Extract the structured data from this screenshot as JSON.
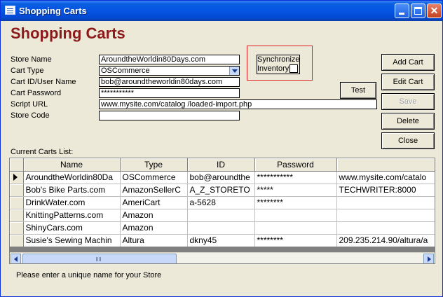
{
  "window": {
    "title": "Shopping Carts"
  },
  "heading": "Shopping Carts",
  "form": {
    "store_name": {
      "label": "Store Name",
      "value": "AroundtheWorldin80Days.com"
    },
    "cart_type": {
      "label": "Cart Type",
      "value": "OSCommerce"
    },
    "cart_id": {
      "label": "Cart ID/User Name",
      "value": "bob@aroundtheworldin80days.com"
    },
    "cart_password": {
      "label": "Cart Password",
      "value": "***********"
    },
    "script_url": {
      "label": "Script URL",
      "value": "www.mysite.com/catalog /loaded-import.php"
    },
    "store_code": {
      "label": "Store Code",
      "value": ""
    }
  },
  "sync": {
    "line1": "Synchronize",
    "line2": "Inventory",
    "checked": false
  },
  "buttons": {
    "add_cart": "Add Cart",
    "edit_cart": "Edit Cart",
    "save": "Save",
    "delete": "Delete",
    "close": "Close",
    "test": "Test"
  },
  "list": {
    "label": "Current Carts List:",
    "columns": [
      "Name",
      "Type",
      "ID",
      "Password",
      ""
    ],
    "rows": [
      [
        "AroundtheWorldin80Da",
        "OSCommerce",
        "bob@aroundthe",
        "***********",
        "www.mysite.com/catalo"
      ],
      [
        "Bob's Bike Parts.com",
        "AmazonSellerC",
        "A_Z_STORETO",
        "*****",
        "TECHWRITER:8000"
      ],
      [
        "DrinkWater.com",
        "AmeriCart",
        "a-5628",
        "********",
        ""
      ],
      [
        "KnittingPatterns.com",
        "Amazon",
        "",
        "",
        ""
      ],
      [
        "ShinyCars.com",
        "Amazon",
        "",
        "",
        ""
      ],
      [
        "Susie's Sewing Machin",
        "Altura",
        "dkny45",
        "********",
        "209.235.214.90/altura/a"
      ]
    ],
    "selected_row": 0
  },
  "status": "Please enter a unique name for your Store"
}
